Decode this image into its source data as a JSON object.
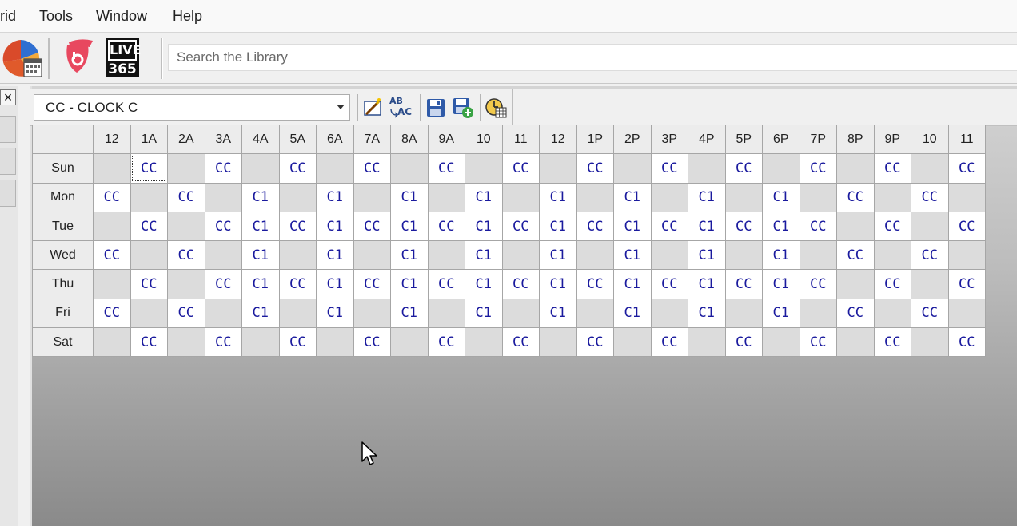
{
  "menu": {
    "items": [
      "rid",
      "Tools",
      "Window",
      "Help"
    ]
  },
  "toolbar": {
    "icons": [
      "pie-chart-calendar-icon",
      "iheart-radio-icon",
      "live365-icon"
    ],
    "live365_text_top": "LIVE",
    "live365_text_bottom": "365",
    "search_placeholder": "Search the Library"
  },
  "left_panel": {
    "close_label": "×"
  },
  "grid_toolbar": {
    "clock_selected": "CC - CLOCK C",
    "buttons": [
      "edit-wand-icon",
      "replace-ab-ac-icon",
      "save-icon",
      "save-add-icon",
      "clock-grid-icon"
    ],
    "replace_text_top": "AB",
    "replace_text_bottom": "AC"
  },
  "grid": {
    "hours": [
      "12",
      "1A",
      "2A",
      "3A",
      "4A",
      "5A",
      "6A",
      "7A",
      "8A",
      "9A",
      "10",
      "11",
      "12",
      "1P",
      "2P",
      "3P",
      "4P",
      "5P",
      "6P",
      "7P",
      "8P",
      "9P",
      "10",
      "11"
    ],
    "days": [
      "Sun",
      "Mon",
      "Tue",
      "Wed",
      "Thu",
      "Fri",
      "Sat"
    ],
    "cells": [
      [
        "",
        "CC",
        "",
        "CC",
        "",
        "CC",
        "",
        "CC",
        "",
        "CC",
        "",
        "CC",
        "",
        "CC",
        "",
        "CC",
        "",
        "CC",
        "",
        "CC",
        "",
        "CC",
        "",
        "CC"
      ],
      [
        "CC",
        "",
        "CC",
        "",
        "C1",
        "",
        "C1",
        "",
        "C1",
        "",
        "C1",
        "",
        "C1",
        "",
        "C1",
        "",
        "C1",
        "",
        "C1",
        "",
        "CC",
        "",
        "CC",
        ""
      ],
      [
        "",
        "CC",
        "",
        "CC",
        "C1",
        "CC",
        "C1",
        "CC",
        "C1",
        "CC",
        "C1",
        "CC",
        "C1",
        "CC",
        "C1",
        "CC",
        "C1",
        "CC",
        "C1",
        "CC",
        "",
        "CC",
        "",
        "CC"
      ],
      [
        "CC",
        "",
        "CC",
        "",
        "C1",
        "",
        "C1",
        "",
        "C1",
        "",
        "C1",
        "",
        "C1",
        "",
        "C1",
        "",
        "C1",
        "",
        "C1",
        "",
        "CC",
        "",
        "CC",
        ""
      ],
      [
        "",
        "CC",
        "",
        "CC",
        "C1",
        "CC",
        "C1",
        "CC",
        "C1",
        "CC",
        "C1",
        "CC",
        "C1",
        "CC",
        "C1",
        "CC",
        "C1",
        "CC",
        "C1",
        "CC",
        "",
        "CC",
        "",
        "CC"
      ],
      [
        "CC",
        "",
        "CC",
        "",
        "C1",
        "",
        "C1",
        "",
        "C1",
        "",
        "C1",
        "",
        "C1",
        "",
        "C1",
        "",
        "C1",
        "",
        "C1",
        "",
        "CC",
        "",
        "CC",
        ""
      ],
      [
        "",
        "CC",
        "",
        "CC",
        "",
        "CC",
        "",
        "CC",
        "",
        "CC",
        "",
        "CC",
        "",
        "CC",
        "",
        "CC",
        "",
        "CC",
        "",
        "CC",
        "",
        "CC",
        "",
        "CC"
      ]
    ],
    "selected": {
      "row": 0,
      "col": 1
    },
    "colors": {
      "code_text": "#1a1a9e",
      "empty_cell": "#dcdcdc",
      "filled_cell": "#ffffff"
    }
  }
}
